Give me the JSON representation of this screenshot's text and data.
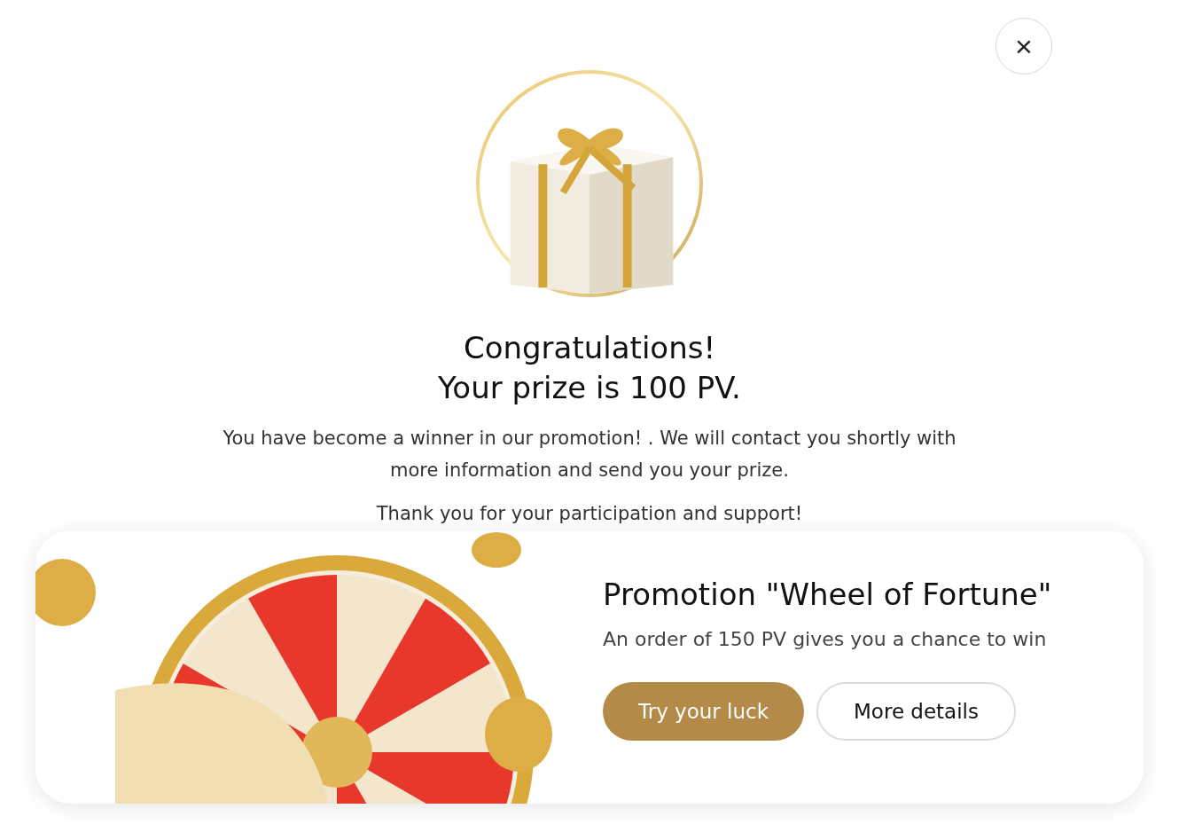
{
  "dialog": {
    "close_button": "×",
    "title_lines": [
      "Congratulations!",
      "Your prize is 100 PV."
    ],
    "message": "You have become a winner in our promotion! . We will contact you shortly with more information and send you your prize.",
    "thanks": "Thank you for your participation and support!"
  },
  "promo": {
    "title": "Promotion \"Wheel of Fortune\"",
    "subtitle": "An order of 150 PV gives you a chance to win",
    "buttons": [
      {
        "label": "Try your luck",
        "kind": "primary"
      },
      {
        "label": "More details",
        "kind": "secondary"
      }
    ]
  }
}
